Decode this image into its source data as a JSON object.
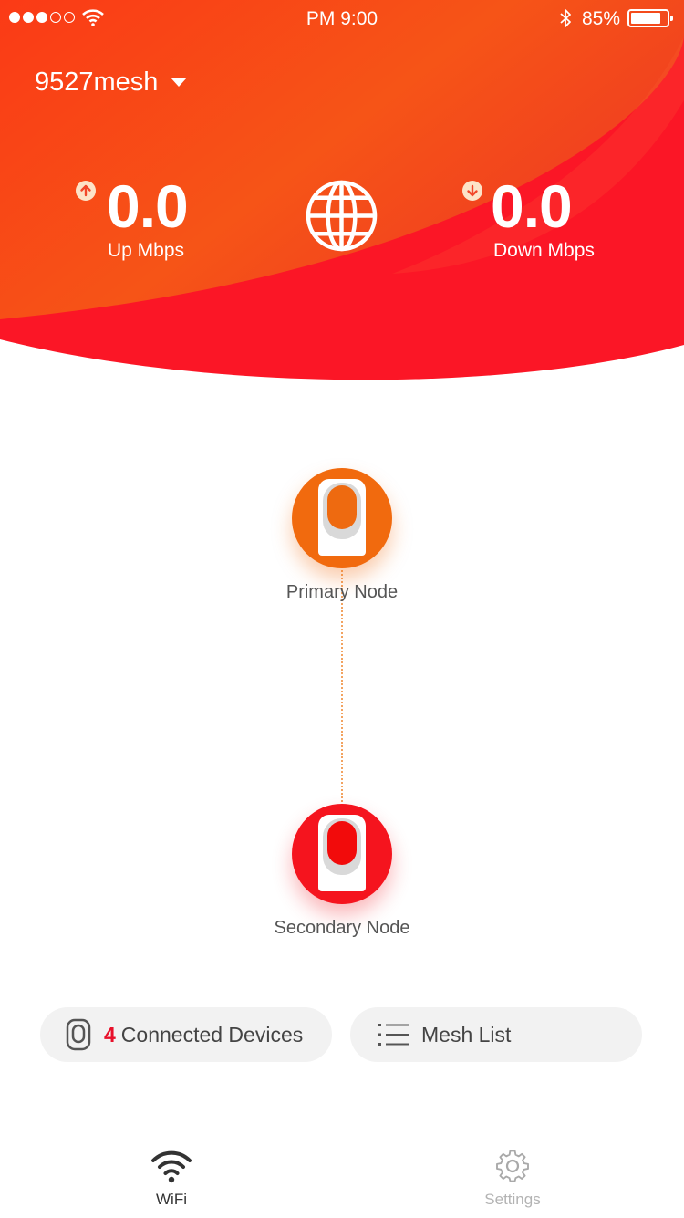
{
  "status_bar": {
    "time": "PM   9:00",
    "battery": "85%",
    "battery_level": 0.85
  },
  "header": {
    "network_name": "9527mesh",
    "upload": {
      "value": "0.0",
      "label": "Up Mbps"
    },
    "download": {
      "value": "0.0",
      "label": "Down Mbps"
    }
  },
  "topology": {
    "primary_label": "Primary Node",
    "secondary_label": "Secondary Node"
  },
  "actions": {
    "devices_count": "4",
    "devices_label": "Connected Devices",
    "mesh_list_label": "Mesh List"
  },
  "tabs": [
    {
      "label": "WiFi",
      "active": true
    },
    {
      "label": "Settings",
      "active": false
    }
  ],
  "colors": {
    "brand_red": "#f5141e",
    "brand_orange": "#f16a0e",
    "count_accent": "#e8112b"
  }
}
